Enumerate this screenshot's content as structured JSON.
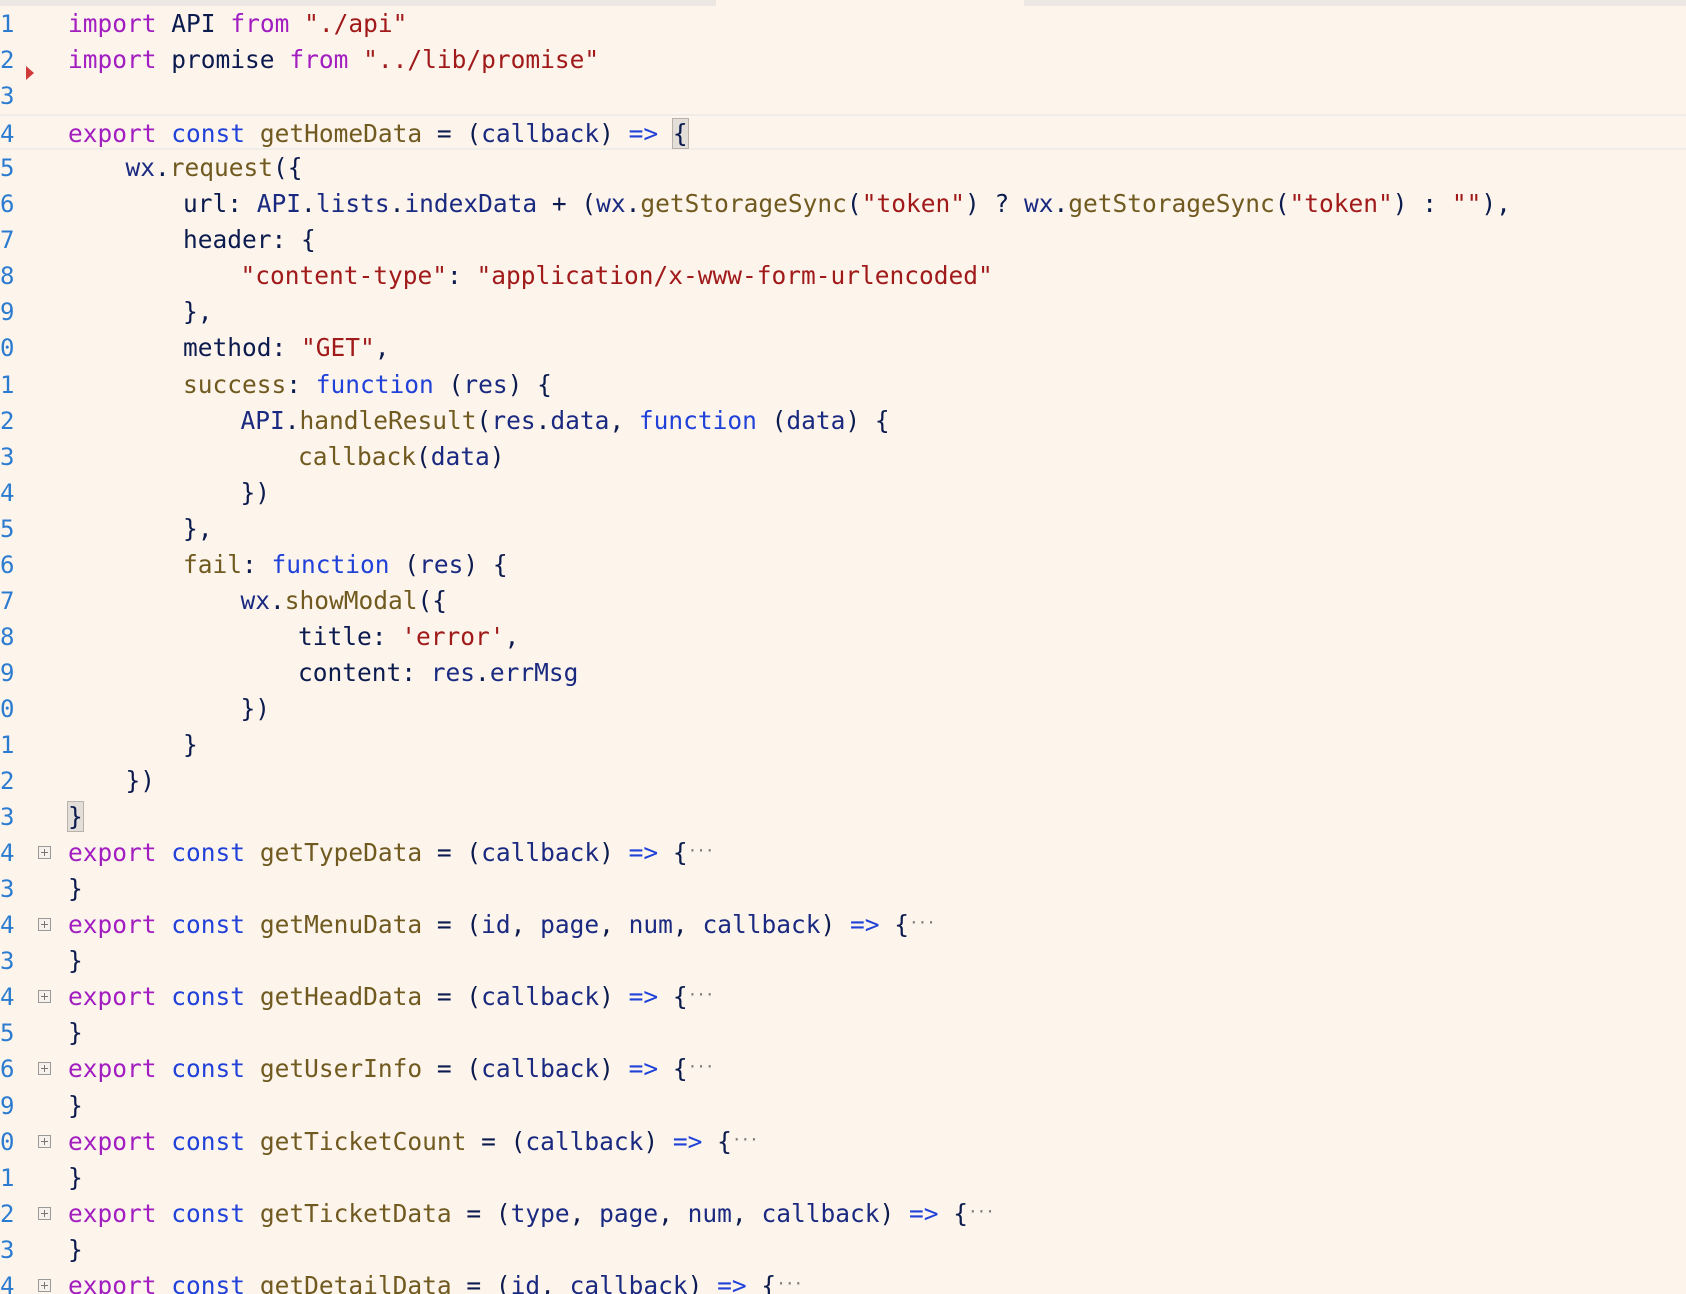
{
  "editor": {
    "background": "#fdf4ec",
    "colors": {
      "keyword": "#a21ec0",
      "storage": "#2042d8",
      "function": "#705a1f",
      "string": "#a01a1a",
      "identifier": "#0c1b4e",
      "line_number": "#2b7bd0",
      "breakpoint_marker": "#d03a3a"
    },
    "lines": [
      {
        "ln": "1",
        "tokens": [
          [
            "keyword",
            "import"
          ],
          [
            "plain",
            " "
          ],
          [
            "ident",
            "API"
          ],
          [
            "plain",
            " "
          ],
          [
            "keyword",
            "from"
          ],
          [
            "plain",
            " "
          ],
          [
            "string",
            "\"./api\""
          ]
        ]
      },
      {
        "ln": "2",
        "tokens": [
          [
            "keyword",
            "import"
          ],
          [
            "plain",
            " "
          ],
          [
            "ident",
            "promise"
          ],
          [
            "plain",
            " "
          ],
          [
            "keyword",
            "from"
          ],
          [
            "plain",
            " "
          ],
          [
            "string",
            "\"../lib/promise\""
          ]
        ]
      },
      {
        "ln": "3",
        "marker": "arrow-right-icon",
        "tokens": []
      },
      {
        "ln": "4",
        "current": true,
        "tokens": [
          [
            "keyword",
            "export"
          ],
          [
            "plain",
            " "
          ],
          [
            "storage",
            "const"
          ],
          [
            "plain",
            " "
          ],
          [
            "func",
            "getHomeData"
          ],
          [
            "plain",
            " = ("
          ],
          [
            "var",
            "callback"
          ],
          [
            "plain",
            ") "
          ],
          [
            "storage",
            "=>"
          ],
          [
            "plain",
            " "
          ],
          [
            "match",
            "{"
          ]
        ]
      },
      {
        "ln": "5",
        "indent": 1,
        "tokens": [
          [
            "var",
            "wx"
          ],
          [
            "plain",
            "."
          ],
          [
            "func",
            "request"
          ],
          [
            "plain",
            "({"
          ]
        ]
      },
      {
        "ln": "6",
        "indent": 2,
        "tokens": [
          [
            "prop",
            "url"
          ],
          [
            "plain",
            ": "
          ],
          [
            "var",
            "API"
          ],
          [
            "plain",
            "."
          ],
          [
            "var",
            "lists"
          ],
          [
            "plain",
            "."
          ],
          [
            "var",
            "indexData"
          ],
          [
            "plain",
            " + ("
          ],
          [
            "var",
            "wx"
          ],
          [
            "plain",
            "."
          ],
          [
            "func",
            "getStorageSync"
          ],
          [
            "plain",
            "("
          ],
          [
            "string",
            "\"token\""
          ],
          [
            "plain",
            ") ? "
          ],
          [
            "var",
            "wx"
          ],
          [
            "plain",
            "."
          ],
          [
            "func",
            "getStorageSync"
          ],
          [
            "plain",
            "("
          ],
          [
            "string",
            "\"token\""
          ],
          [
            "plain",
            ") : "
          ],
          [
            "string",
            "\"\""
          ],
          [
            "plain",
            "),"
          ]
        ]
      },
      {
        "ln": "7",
        "indent": 2,
        "tokens": [
          [
            "prop",
            "header"
          ],
          [
            "plain",
            ": {"
          ]
        ]
      },
      {
        "ln": "8",
        "indent": 3,
        "tokens": [
          [
            "string",
            "\"content-type\""
          ],
          [
            "plain",
            ": "
          ],
          [
            "string",
            "\"application/x-www-form-urlencoded\""
          ]
        ]
      },
      {
        "ln": "9",
        "indent": 2,
        "tokens": [
          [
            "plain",
            "},"
          ]
        ]
      },
      {
        "ln": "0",
        "indent": 2,
        "tokens": [
          [
            "prop",
            "method"
          ],
          [
            "plain",
            ": "
          ],
          [
            "string",
            "\"GET\""
          ],
          [
            "plain",
            ","
          ]
        ]
      },
      {
        "ln": "1",
        "indent": 2,
        "tokens": [
          [
            "func",
            "success"
          ],
          [
            "plain",
            ": "
          ],
          [
            "storage",
            "function"
          ],
          [
            "plain",
            " ("
          ],
          [
            "var",
            "res"
          ],
          [
            "plain",
            ") {"
          ]
        ]
      },
      {
        "ln": "2",
        "indent": 3,
        "tokens": [
          [
            "var",
            "API"
          ],
          [
            "plain",
            "."
          ],
          [
            "func",
            "handleResult"
          ],
          [
            "plain",
            "("
          ],
          [
            "var",
            "res"
          ],
          [
            "plain",
            "."
          ],
          [
            "var",
            "data"
          ],
          [
            "plain",
            ", "
          ],
          [
            "storage",
            "function"
          ],
          [
            "plain",
            " ("
          ],
          [
            "var",
            "data"
          ],
          [
            "plain",
            ") {"
          ]
        ]
      },
      {
        "ln": "3",
        "indent": 4,
        "tokens": [
          [
            "func",
            "callback"
          ],
          [
            "plain",
            "("
          ],
          [
            "var",
            "data"
          ],
          [
            "plain",
            ")"
          ]
        ]
      },
      {
        "ln": "4",
        "indent": 3,
        "tokens": [
          [
            "plain",
            "})"
          ]
        ]
      },
      {
        "ln": "5",
        "indent": 2,
        "tokens": [
          [
            "plain",
            "},"
          ]
        ]
      },
      {
        "ln": "6",
        "indent": 2,
        "tokens": [
          [
            "func",
            "fail"
          ],
          [
            "plain",
            ": "
          ],
          [
            "storage",
            "function"
          ],
          [
            "plain",
            " ("
          ],
          [
            "var",
            "res"
          ],
          [
            "plain",
            ") {"
          ]
        ]
      },
      {
        "ln": "7",
        "indent": 3,
        "tokens": [
          [
            "var",
            "wx"
          ],
          [
            "plain",
            "."
          ],
          [
            "func",
            "showModal"
          ],
          [
            "plain",
            "({"
          ]
        ]
      },
      {
        "ln": "8",
        "indent": 4,
        "tokens": [
          [
            "prop",
            "title"
          ],
          [
            "plain",
            ": "
          ],
          [
            "string",
            "'error'"
          ],
          [
            "plain",
            ","
          ]
        ]
      },
      {
        "ln": "9",
        "indent": 4,
        "tokens": [
          [
            "prop",
            "content"
          ],
          [
            "plain",
            ": "
          ],
          [
            "var",
            "res"
          ],
          [
            "plain",
            "."
          ],
          [
            "var",
            "errMsg"
          ]
        ]
      },
      {
        "ln": "0",
        "indent": 3,
        "tokens": [
          [
            "plain",
            "})"
          ]
        ]
      },
      {
        "ln": "1",
        "indent": 2,
        "tokens": [
          [
            "plain",
            "}"
          ]
        ]
      },
      {
        "ln": "2",
        "indent": 1,
        "tokens": [
          [
            "plain",
            "})"
          ]
        ]
      },
      {
        "ln": "3",
        "tokens": [
          [
            "match",
            "}"
          ]
        ]
      },
      {
        "ln": "4",
        "fold": true,
        "tokens": [
          [
            "keyword",
            "export"
          ],
          [
            "plain",
            " "
          ],
          [
            "storage",
            "const"
          ],
          [
            "plain",
            " "
          ],
          [
            "func",
            "getTypeData"
          ],
          [
            "plain",
            " = ("
          ],
          [
            "var",
            "callback"
          ],
          [
            "plain",
            ") "
          ],
          [
            "storage",
            "=>"
          ],
          [
            "plain",
            " {"
          ],
          [
            "ellipsis",
            "···"
          ]
        ]
      },
      {
        "ln": "3",
        "tokens": [
          [
            "plain",
            "}"
          ]
        ]
      },
      {
        "ln": "4",
        "fold": true,
        "tokens": [
          [
            "keyword",
            "export"
          ],
          [
            "plain",
            " "
          ],
          [
            "storage",
            "const"
          ],
          [
            "plain",
            " "
          ],
          [
            "func",
            "getMenuData"
          ],
          [
            "plain",
            " = ("
          ],
          [
            "var",
            "id"
          ],
          [
            "plain",
            ", "
          ],
          [
            "var",
            "page"
          ],
          [
            "plain",
            ", "
          ],
          [
            "var",
            "num"
          ],
          [
            "plain",
            ", "
          ],
          [
            "var",
            "callback"
          ],
          [
            "plain",
            ") "
          ],
          [
            "storage",
            "=>"
          ],
          [
            "plain",
            " {"
          ],
          [
            "ellipsis",
            "···"
          ]
        ]
      },
      {
        "ln": "3",
        "tokens": [
          [
            "plain",
            "}"
          ]
        ]
      },
      {
        "ln": "4",
        "fold": true,
        "tokens": [
          [
            "keyword",
            "export"
          ],
          [
            "plain",
            " "
          ],
          [
            "storage",
            "const"
          ],
          [
            "plain",
            " "
          ],
          [
            "func",
            "getHeadData"
          ],
          [
            "plain",
            " = ("
          ],
          [
            "var",
            "callback"
          ],
          [
            "plain",
            ") "
          ],
          [
            "storage",
            "=>"
          ],
          [
            "plain",
            " {"
          ],
          [
            "ellipsis",
            "···"
          ]
        ]
      },
      {
        "ln": "5",
        "tokens": [
          [
            "plain",
            "}"
          ]
        ]
      },
      {
        "ln": "6",
        "fold": true,
        "tokens": [
          [
            "keyword",
            "export"
          ],
          [
            "plain",
            " "
          ],
          [
            "storage",
            "const"
          ],
          [
            "plain",
            " "
          ],
          [
            "func",
            "getUserInfo"
          ],
          [
            "plain",
            " = ("
          ],
          [
            "var",
            "callback"
          ],
          [
            "plain",
            ") "
          ],
          [
            "storage",
            "=>"
          ],
          [
            "plain",
            " {"
          ],
          [
            "ellipsis",
            "···"
          ]
        ]
      },
      {
        "ln": "9",
        "tokens": [
          [
            "plain",
            "}"
          ]
        ]
      },
      {
        "ln": "0",
        "fold": true,
        "tokens": [
          [
            "keyword",
            "export"
          ],
          [
            "plain",
            " "
          ],
          [
            "storage",
            "const"
          ],
          [
            "plain",
            " "
          ],
          [
            "func",
            "getTicketCount"
          ],
          [
            "plain",
            " = ("
          ],
          [
            "var",
            "callback"
          ],
          [
            "plain",
            ") "
          ],
          [
            "storage",
            "=>"
          ],
          [
            "plain",
            " {"
          ],
          [
            "ellipsis",
            "···"
          ]
        ]
      },
      {
        "ln": "1",
        "tokens": [
          [
            "plain",
            "}"
          ]
        ]
      },
      {
        "ln": "2",
        "fold": true,
        "tokens": [
          [
            "keyword",
            "export"
          ],
          [
            "plain",
            " "
          ],
          [
            "storage",
            "const"
          ],
          [
            "plain",
            " "
          ],
          [
            "func",
            "getTicketData"
          ],
          [
            "plain",
            " = ("
          ],
          [
            "var",
            "type"
          ],
          [
            "plain",
            ", "
          ],
          [
            "var",
            "page"
          ],
          [
            "plain",
            ", "
          ],
          [
            "var",
            "num"
          ],
          [
            "plain",
            ", "
          ],
          [
            "var",
            "callback"
          ],
          [
            "plain",
            ") "
          ],
          [
            "storage",
            "=>"
          ],
          [
            "plain",
            " {"
          ],
          [
            "ellipsis",
            "···"
          ]
        ]
      },
      {
        "ln": "3",
        "tokens": [
          [
            "plain",
            "}"
          ]
        ]
      },
      {
        "ln": "4",
        "fold": true,
        "tokens": [
          [
            "keyword",
            "export"
          ],
          [
            "plain",
            " "
          ],
          [
            "storage",
            "const"
          ],
          [
            "plain",
            " "
          ],
          [
            "func",
            "getDetailData"
          ],
          [
            "plain",
            " = ("
          ],
          [
            "var",
            "id"
          ],
          [
            "plain",
            ", "
          ],
          [
            "var",
            "callback"
          ],
          [
            "plain",
            ") "
          ],
          [
            "storage",
            "=>"
          ],
          [
            "plain",
            " {"
          ],
          [
            "ellipsis",
            "···"
          ]
        ]
      }
    ]
  }
}
